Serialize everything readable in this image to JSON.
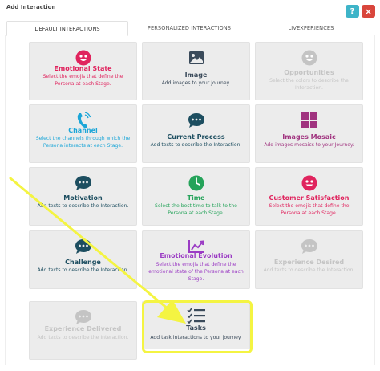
{
  "dialog": {
    "title": "Add Interaction",
    "help_label": "?",
    "close_label": "×"
  },
  "tabs": [
    {
      "label": "DEFAULT INTERACTIONS",
      "active": true
    },
    {
      "label": "PERSONALIZED INTERACTIONS",
      "active": false
    },
    {
      "label": "LIVEXPERIENCES",
      "active": false
    }
  ],
  "cards": [
    {
      "name": "Emotional State",
      "desc": "Select the emojis that define the Persona at each Stage.",
      "color": "#e0245e",
      "icon": "smiley-icon",
      "enabled": true
    },
    {
      "name": "Image",
      "desc": "Add images to your Journey.",
      "color": "#3a4a5a",
      "icon": "image-icon",
      "enabled": true
    },
    {
      "name": "Opportunities",
      "desc": "Select the colors to describe the Interaction.",
      "color": "#c4c4c4",
      "icon": "smiley-icon",
      "enabled": false
    },
    {
      "name": "Channel",
      "desc": "Select the channels through which the Persona interacts at each Stage.",
      "color": "#1ba6d8",
      "icon": "phone-icon",
      "enabled": true
    },
    {
      "name": "Current Process",
      "desc": "Add texts to describe the Interaction.",
      "color": "#1d4e60",
      "icon": "chat-icon",
      "enabled": true
    },
    {
      "name": "Images Mosaic",
      "desc": "Add images mosaics to your Journey.",
      "color": "#a0337f",
      "icon": "mosaic-icon",
      "enabled": true
    },
    {
      "name": "Motivation",
      "desc": "Add texts to describe the Interaction.",
      "color": "#1d4e60",
      "icon": "chat-icon",
      "enabled": true
    },
    {
      "name": "Time",
      "desc": "Select the best time to talk to the Persona at each Stage.",
      "color": "#25a35a",
      "icon": "clock-icon",
      "enabled": true
    },
    {
      "name": "Customer Satisfaction",
      "desc": "Select the emojis that define the Persona at each Stage.",
      "color": "#e0245e",
      "icon": "smiley-icon",
      "enabled": true
    },
    {
      "name": "Challenge",
      "desc": "Add texts to describe the Interaction.",
      "color": "#1d4e60",
      "icon": "chat-icon",
      "enabled": true
    },
    {
      "name": "Emotional Evolution",
      "desc": "Select the emojis that define the emotional state of the Persona at each Stage.",
      "color": "#9b3cc4",
      "icon": "chart-icon",
      "enabled": true
    },
    {
      "name": "Experience Desired",
      "desc": "Add texts to describe the Interaction.",
      "color": "#c4c4c4",
      "icon": "chat-icon",
      "enabled": false
    },
    {
      "name": "Experience Delivered",
      "desc": "Add texts to describe the Interaction.",
      "color": "#c4c4c4",
      "icon": "chat-icon",
      "enabled": false
    },
    {
      "name": "Tasks",
      "desc": "Add task interactions to your journey.",
      "color": "#3a4a5a",
      "icon": "checklist-icon",
      "enabled": true
    }
  ],
  "annotation": {
    "highlight_color": "#f4f442",
    "target": "Tasks"
  }
}
